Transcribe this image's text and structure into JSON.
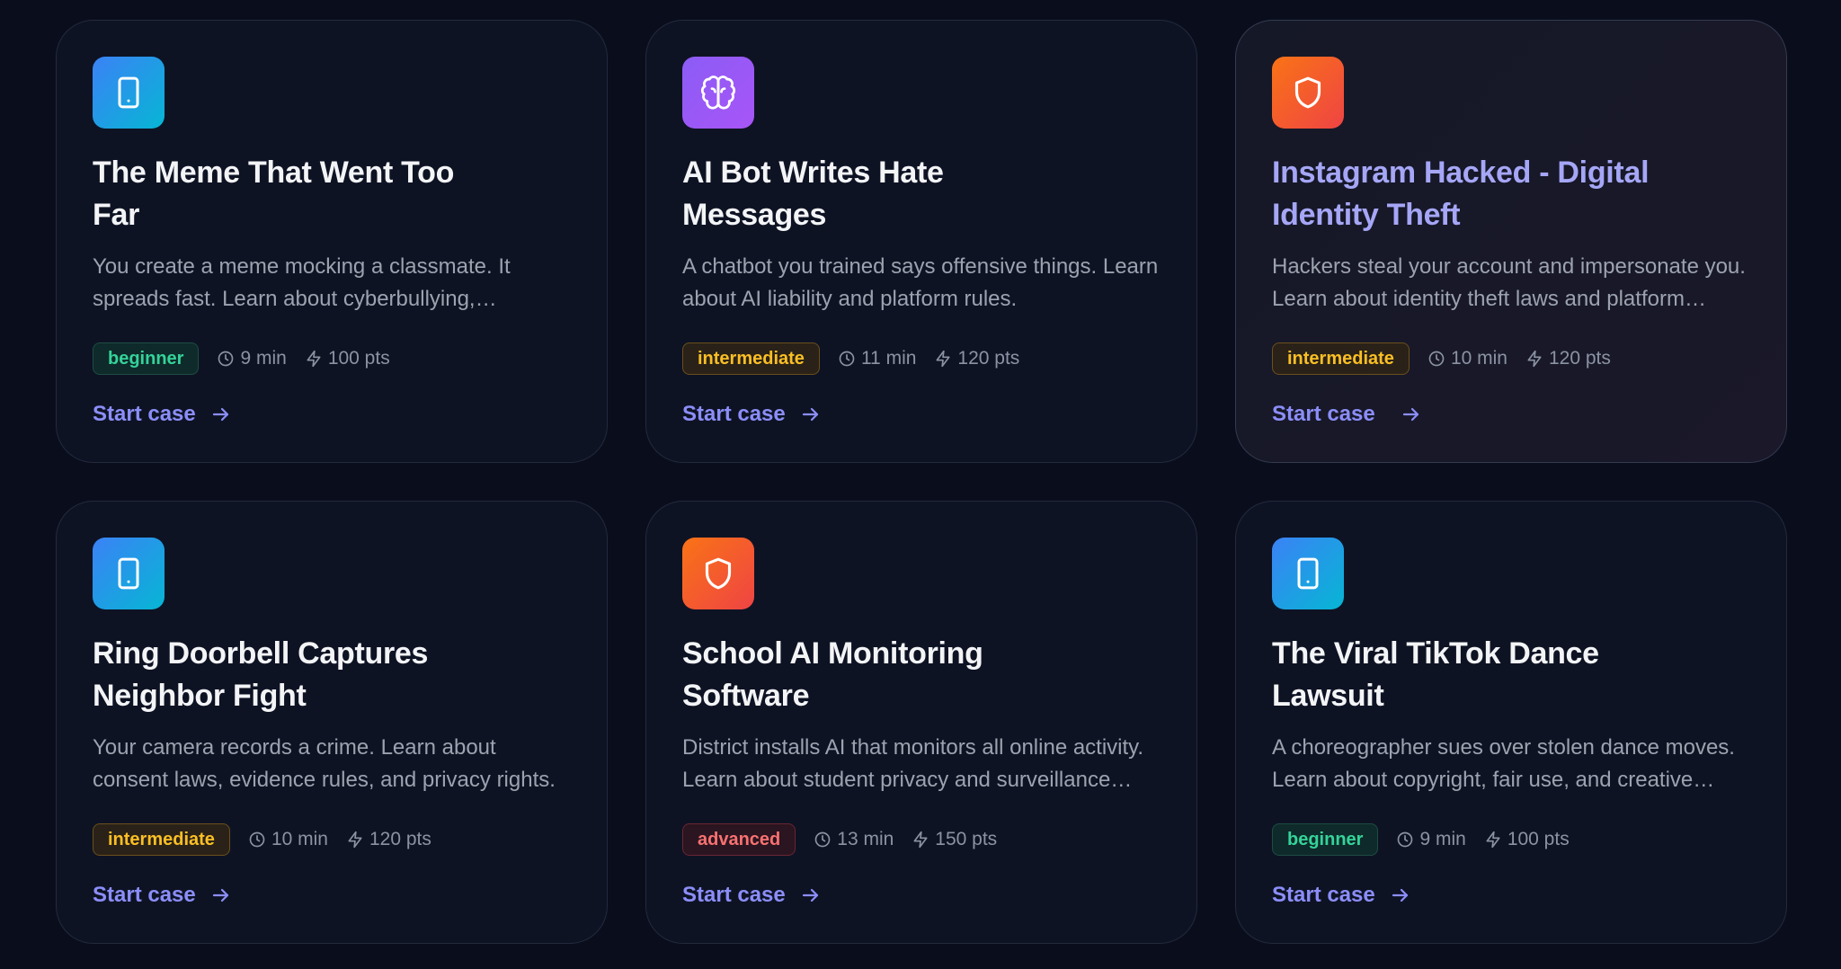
{
  "labels": {
    "start": "Start case"
  },
  "cases": [
    {
      "title": "The Meme That Went Too Far",
      "description": "You create a meme mocking a classmate. It spreads fast. Learn about cyberbullying, harassment laws, and school discipline.",
      "icon": "phone-icon",
      "icon_gradient": [
        "#3b82f6",
        "#06b6d4"
      ],
      "level": "beginner",
      "duration": "9 min",
      "points": "100 pts"
    },
    {
      "title": "AI Bot Writes Hate Messages",
      "description": "A chatbot you trained says offensive things. Learn about AI liability and platform rules.",
      "icon": "brain-icon",
      "icon_gradient": [
        "#8b5cf6",
        "#a855f7"
      ],
      "level": "intermediate",
      "duration": "11 min",
      "points": "120 pts"
    },
    {
      "title": "Instagram Hacked - Digital Identity Theft",
      "description": "Hackers steal your account and impersonate you. Learn about identity theft laws and platform responsibility.",
      "icon": "shield-icon",
      "icon_gradient": [
        "#f97316",
        "#ef4444"
      ],
      "level": "intermediate",
      "duration": "10 min",
      "points": "120 pts"
    },
    {
      "title": "Ring Doorbell Captures Neighbor Fight",
      "description": "Your camera records a crime. Learn about consent laws, evidence rules, and privacy rights.",
      "icon": "phone-icon",
      "icon_gradient": [
        "#3b82f6",
        "#06b6d4"
      ],
      "level": "intermediate",
      "duration": "10 min",
      "points": "120 pts"
    },
    {
      "title": "School AI Monitoring Software",
      "description": "District installs AI that monitors all online activity. Learn about student privacy and surveillance limits.",
      "icon": "shield-icon",
      "icon_gradient": [
        "#f97316",
        "#ef4444"
      ],
      "level": "advanced",
      "duration": "13 min",
      "points": "150 pts"
    },
    {
      "title": "The Viral TikTok Dance Lawsuit",
      "description": "A choreographer sues over stolen dance moves. Learn about copyright, fair use, and creative ownership.",
      "icon": "phone-icon",
      "icon_gradient": [
        "#3b82f6",
        "#06b6d4"
      ],
      "level": "beginner",
      "duration": "9 min",
      "points": "100 pts"
    }
  ],
  "colors": {
    "background": "#0a0e1c",
    "card": "#0e1324",
    "accent": "#8b8ef8",
    "beginner": "#34d399",
    "intermediate": "#fbbf24",
    "advanced": "#f87171"
  }
}
